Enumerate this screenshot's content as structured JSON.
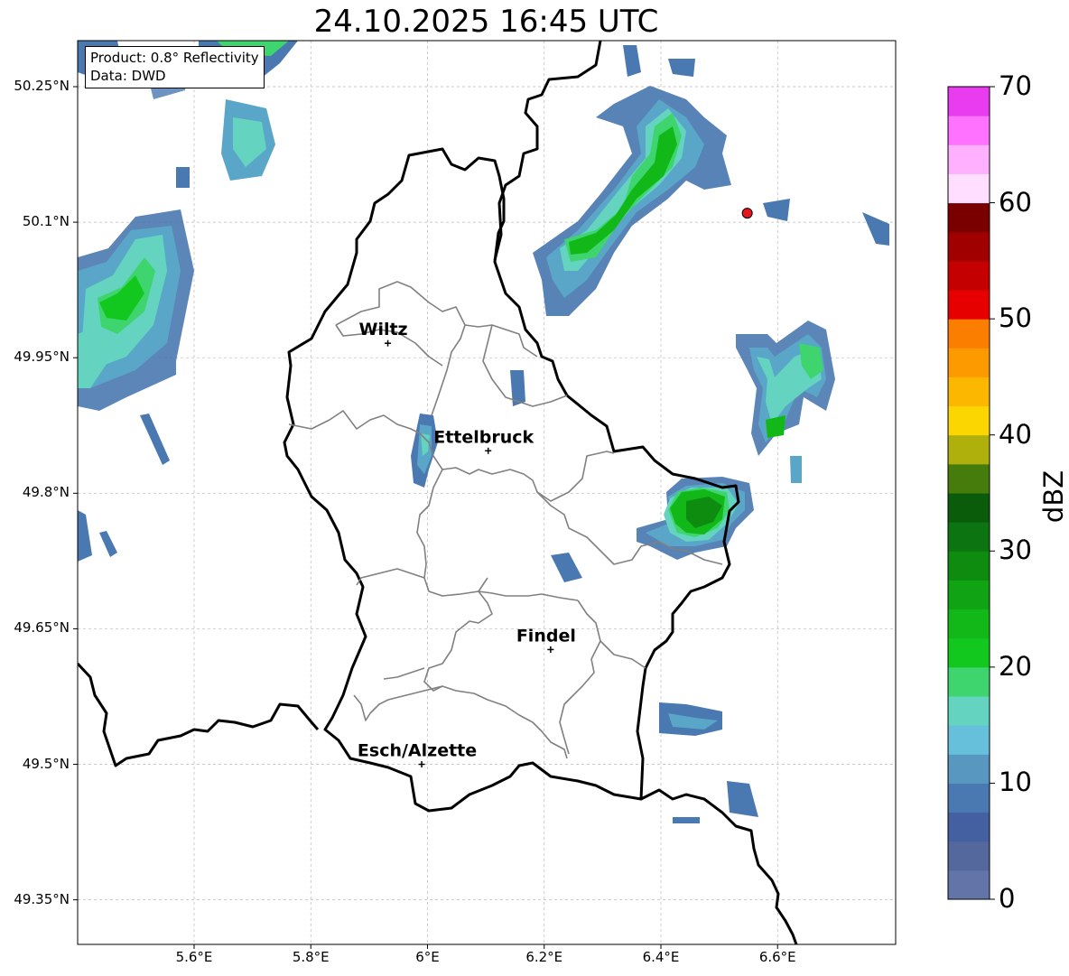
{
  "title": "24.10.2025 16:45 UTC",
  "info": {
    "product": "Product: 0.8° Reflectivity",
    "source": "Data: DWD"
  },
  "lat_ticks": [
    {
      "value": 50.25,
      "label": "50.25°N"
    },
    {
      "value": 50.1,
      "label": "50.1°N"
    },
    {
      "value": 49.95,
      "label": "49.95°N"
    },
    {
      "value": 49.8,
      "label": "49.8°N"
    },
    {
      "value": 49.65,
      "label": "49.65°N"
    },
    {
      "value": 49.5,
      "label": "49.5°N"
    },
    {
      "value": 49.35,
      "label": "49.35°N"
    }
  ],
  "lon_ticks": [
    {
      "value": 5.6,
      "label": "5.6°E"
    },
    {
      "value": 5.8,
      "label": "5.8°E"
    },
    {
      "value": 6.0,
      "label": "6°E"
    },
    {
      "value": 6.2,
      "label": "6.2°E"
    },
    {
      "value": 6.4,
      "label": "6.4°E"
    },
    {
      "value": 6.6,
      "label": "6.6°E"
    }
  ],
  "cities": [
    {
      "name": "Wiltz",
      "lon": 5.932,
      "lat": 49.966
    },
    {
      "name": "Ettelbruck",
      "lon": 6.104,
      "lat": 49.847
    },
    {
      "name": "Findel",
      "lon": 6.211,
      "lat": 49.627
    },
    {
      "name": "Esch/Alzette",
      "lon": 5.99,
      "lat": 49.5
    }
  ],
  "radar_site": {
    "lon": 6.548,
    "lat": 50.11,
    "color": "#e8141e"
  },
  "colorbar": {
    "label": "dBZ",
    "min": 0,
    "max": 70,
    "ticks": [
      "0",
      "10",
      "20",
      "30",
      "40",
      "50",
      "60",
      "70"
    ],
    "colors": [
      "#6374a8",
      "#55689e",
      "#4460a0",
      "#4a78b0",
      "#5898c0",
      "#66c0dc",
      "#64d4c0",
      "#3ed46e",
      "#12c81e",
      "#12b818",
      "#10a414",
      "#0e8c10",
      "#0c7410",
      "#0a5c0a",
      "#467c0c",
      "#afb00c",
      "#fcd600",
      "#fcb800",
      "#fc9a00",
      "#fc7e00",
      "#e60000",
      "#c40000",
      "#a00000",
      "#7a0000",
      "#ffdeff",
      "#ffb0ff",
      "#ff72ff",
      "#e93cf0"
    ]
  }
}
